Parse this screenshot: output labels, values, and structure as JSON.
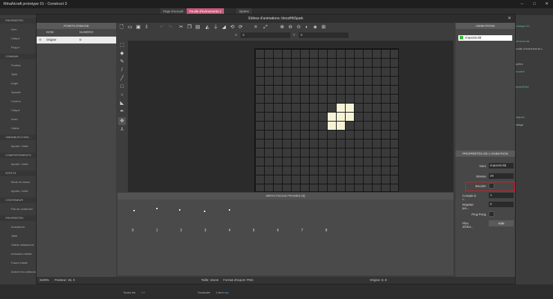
{
  "window": {
    "title": "MinaNcraft prototype 01 - Construct 3"
  },
  "bg_tabs": [
    "Page d'accueil",
    "Feuille d'évènements 1",
    "Sprites"
  ],
  "left_panel": {
    "rows": [
      {
        "label": "PROPRIÉTÉS",
        "sec": true
      },
      {
        "label": "Nom"
      },
      {
        "label": "Calque"
      },
      {
        "label": "Plug-in"
      },
      {
        "label": "COMMUN",
        "sec": true
      },
      {
        "label": "Position"
      },
      {
        "label": "Taille"
      },
      {
        "label": "Angle"
      },
      {
        "label": "Opacité"
      },
      {
        "label": "Couleur"
      },
      {
        "label": "Calque"
      },
      {
        "label": "Index"
      },
      {
        "label": "Visible"
      },
      {
        "label": "VARIABLES D'INS...",
        "sec": true
      },
      {
        "label": "Ajouter / édite"
      },
      {
        "label": "COMPORTEMENTS",
        "sec": true
      },
      {
        "label": "Ajouter / édite"
      },
      {
        "label": "EFFETS",
        "sec": true
      },
      {
        "label": "Mode de fusion"
      },
      {
        "label": "Ajouter / édite"
      },
      {
        "label": "CONTENEUR",
        "sec": true
      },
      {
        "label": "Pas de conteneur"
      },
      {
        "label": "PROPRIÉTÉS",
        "sec": true
      },
      {
        "label": "Animations"
      },
      {
        "label": "Taille"
      },
      {
        "label": "Visible initialement"
      },
      {
        "label": "Animation initiale"
      },
      {
        "label": "Frame initiale"
      },
      {
        "label": "Activer les collisions"
      }
    ]
  },
  "right_panel": {
    "title": "PROJET",
    "items": [
      "prototype 01",
      "...",
      "évènements",
      "Feuille d'évènements 1",
      "...",
      "Sprites",
      "bloodHit",
      "...",
      "impactSolid",
      "...",
      "...",
      "...",
      "Calques",
      "Tuilage"
    ],
    "bottom_buttons": [
      "Calqu...",
      "Tuilage",
      "Droite en..."
    ]
  },
  "bottom": {
    "labels": [
      "Toutes les",
      "1.0",
      "Soustraire",
      "1 de",
      "temps"
    ]
  },
  "dialog": {
    "title": "Éditeur d'animations: bloodHitSpark",
    "image_points": {
      "header": "POINTS D'IMAGE",
      "col_name": "NOM",
      "col_number": "NUMÉRO",
      "rows": [
        {
          "name": "Origine",
          "number": "0"
        }
      ]
    },
    "coords": {
      "x_label": "X",
      "x_value": "0",
      "y_label": "Y",
      "y_value": "0"
    },
    "animations": {
      "header": "ANIMATIONS",
      "items": [
        {
          "name": "impactSolid",
          "selected": true
        }
      ]
    },
    "frames": {
      "header": "IMPACTSOLID FRAMES (8)",
      "numbers": [
        "0",
        "1",
        "2",
        "3",
        "4",
        "5",
        "6",
        "7",
        "8"
      ]
    },
    "properties": {
      "header": "PROPRIÉTÉS DE L'ANIMATION",
      "name_label": "Nom",
      "name_value": "impactSolid",
      "speed_label": "Vitesse",
      "speed_value": "26",
      "loop_label": "Boucler",
      "loop_checked": false,
      "repeat_count_label": "Compte à r...",
      "repeat_count_value": "1",
      "repeat_to_label": "Répéter jus...",
      "repeat_to_value": "0",
      "pingpong_label": "Ping Pong",
      "pingpong_checked": false,
      "more_label": "Plus d'infor...",
      "help_button": "Aide"
    },
    "status": {
      "zoom": "3100%",
      "pointer": "Pointeur: 26, 0",
      "size": "Taille: 16x16",
      "format": "Format d'export: PNG",
      "origin": "Origine: 8, 8"
    },
    "sprite_pixels": [
      [
        9,
        6
      ],
      [
        10,
        6
      ],
      [
        8,
        7
      ],
      [
        9,
        7
      ],
      [
        10,
        7
      ],
      [
        8,
        8
      ],
      [
        9,
        8
      ]
    ]
  },
  "colors": {
    "highlight_red": "#d0202a",
    "selected_green": "#3dbb3d",
    "pixel": "#f6f2d6"
  }
}
